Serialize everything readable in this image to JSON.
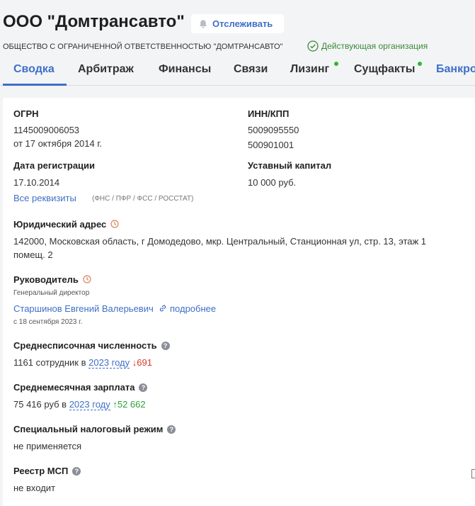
{
  "header": {
    "company_name": "ООО \"Домтрансавто\"",
    "follow_label": "Отслеживать",
    "full_name": "ОБЩЕСТВО С ОГРАНИЧЕННОЙ ОТВЕТСТВЕННОСТЬЮ \"ДОМТРАНСАВТО\"",
    "status": "Действующая организация"
  },
  "tabs": [
    {
      "label": "Сводка",
      "active": true
    },
    {
      "label": "Арбитраж"
    },
    {
      "label": "Финансы"
    },
    {
      "label": "Связи"
    },
    {
      "label": "Лизинг",
      "dot": true
    },
    {
      "label": "Сущфакты",
      "dot": true
    },
    {
      "label": "Банкро"
    }
  ],
  "summary": {
    "ogrn_label": "ОГРН",
    "ogrn": "1145009006053",
    "ogrn_date": "от 17 октября 2014 г.",
    "inn_label": "ИНН/КПП",
    "inn": "5009095550",
    "kpp": "500901001",
    "reg_label": "Дата регистрации",
    "reg_date": "17.10.2014",
    "capital_label": "Уставный капитал",
    "capital": "10 000 руб.",
    "all_details": "Все реквизиты",
    "sources": "(ФНС / ПФР / ФСС / РОССТАТ)",
    "address_label": "Юридический адрес",
    "address_line1": "142000, Московская область, г Домодедово, мкр. Центральный, Станционная ул, стр. 13, этаж 1",
    "address_line2": "помещ. 2",
    "head_label": "Руководитель",
    "head_position": "Генеральный директор",
    "head_name": "Старшинов Евгений Валерьевич",
    "head_more": "подробнее",
    "head_since": "с 18 сентября 2023 г.",
    "employees_label": "Среднесписочная численность",
    "employees_text": "1161 сотрудник в",
    "employees_year": "2023 году",
    "employees_delta": "↓691",
    "salary_label": "Среднемесячная зарплата",
    "salary_text": "75 416 руб в",
    "salary_year": "2023 году",
    "salary_delta": "↑52 662",
    "tax_label": "Специальный налоговый режим",
    "tax_value": "не применяется",
    "msp_label": "Реестр МСП",
    "msp_value": "не входит"
  },
  "colors": {
    "accent": "#3e6fc8",
    "status_green": "#3a8a3a",
    "decrease": "#d33a2c",
    "increase": "#2e9e3a"
  },
  "icons": [
    "bell-icon",
    "check-circle-icon",
    "clock-icon",
    "link-icon",
    "help-icon"
  ]
}
